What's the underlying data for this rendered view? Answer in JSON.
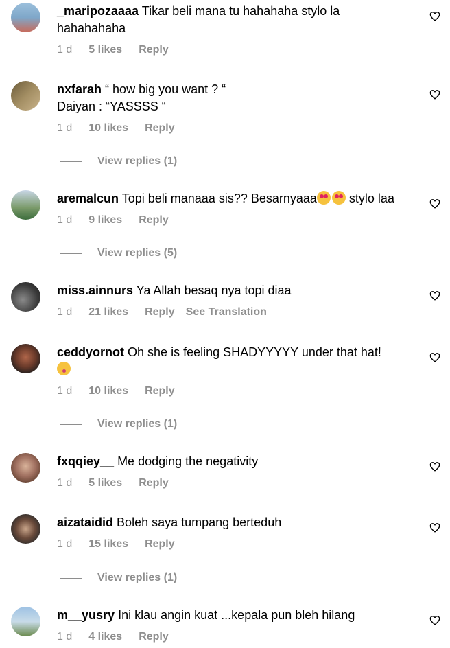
{
  "comments": [
    {
      "username": "_maripozaaaa",
      "text": "Tikar beli mana tu hahahaha stylo la hahahahaha",
      "age": "1 d",
      "likes": "5 likes",
      "reply": "Reply",
      "avatar_colors": [
        "#7fa7c9",
        "#c96a5a"
      ]
    },
    {
      "username": "nxfarah",
      "text": "“ how big you want ? “",
      "text2": "Daiyan : “YASSSS “",
      "age": "1 d",
      "likes": "10 likes",
      "reply": "Reply",
      "view_replies": "View replies (1)",
      "avatar_colors": [
        "#6b5b3a",
        "#c9b38a"
      ]
    },
    {
      "username": "aremalcun",
      "text": "Topi beli manaaa sis?? Besarnyaaa",
      "text_after": " stylo laa",
      "emoji": "heart-eyes",
      "age": "1 d",
      "likes": "9 likes",
      "reply": "Reply",
      "view_replies": "View replies (5)",
      "avatar_colors": [
        "#3c6d3c",
        "#c8d6e6"
      ]
    },
    {
      "username": "miss.ainnurs",
      "text": "Ya Allah besaq nya topi diaa",
      "age": "1 d",
      "likes": "21 likes",
      "reply": "Reply",
      "see_translation": "See Translation",
      "avatar_colors": [
        "#2a2a2a",
        "#8a8a8a"
      ]
    },
    {
      "username": "ceddyornot",
      "text": "Oh she is feeling SHADYYYYY under that hat!",
      "emoji": "kiss",
      "age": "1 d",
      "likes": "10 likes",
      "reply": "Reply",
      "view_replies": "View replies (1)",
      "avatar_colors": [
        "#1e1e1e",
        "#b0664a"
      ]
    },
    {
      "username": "fxqqiey__",
      "text": "Me dodging the negativity",
      "age": "1 d",
      "likes": "5 likes",
      "reply": "Reply",
      "avatar_colors": [
        "#d9b39a",
        "#5a3a2a"
      ]
    },
    {
      "username": "aizataidid",
      "text": "Boleh saya tumpang berteduh",
      "age": "1 d",
      "likes": "15 likes",
      "reply": "Reply",
      "view_replies": "View replies (1)",
      "avatar_colors": [
        "#2b2b2b",
        "#c9a58a"
      ]
    },
    {
      "username": "m__yusry",
      "text": "Ini klau angin kuat ...kepala pun bleh hilang",
      "age": "1 d",
      "likes": "4 likes",
      "reply": "Reply",
      "avatar_colors": [
        "#9ec2e4",
        "#6b8a4e"
      ]
    }
  ]
}
